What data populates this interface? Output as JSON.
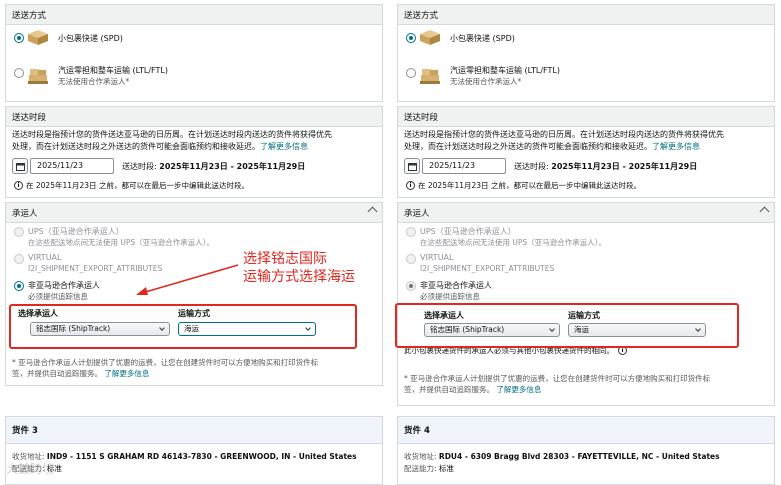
{
  "panels": [
    {
      "shipping_method": {
        "title": "送送方式",
        "options": [
          {
            "label": "小包裹快递 (SPD)",
            "sublabel": "",
            "selected": true,
            "icon": "small-parcel-icon"
          },
          {
            "label": "汽运零担和整车运输 (LTL/FTL)",
            "sublabel": "无法使用合作承运人*",
            "selected": false,
            "icon": "pallet-icon"
          }
        ]
      },
      "delivery_window": {
        "title": "送达时段",
        "description_line1": "送达时段是指预计您的货件送达亚马逊的日历周。在计划送达时段内送达的货件将获得优先",
        "description_line2": "处理，而在计划送达时段之外送达的货件可能会面临预约和接收延迟。",
        "learn_more": "了解更多信息",
        "date_value": "2025/11/23",
        "window_label": "送达时段:",
        "window_value": "2025年11月23日 - 2025年11月29日",
        "info": "在 2025年11月23日 之前，都可以在最后一步中编辑此送达时段。"
      },
      "carrier": {
        "title": "承运人",
        "options": [
          {
            "label": "UPS（亚马逊合作承运人）",
            "sublabel": "在这些配送地点间无法使用 UPS（亚马逊合作承运人）。",
            "selected": false,
            "disabled": true
          },
          {
            "label": "VIRTUAL",
            "sublabel": "I2I_SHIPMENT_EXPORT_ATTRIBUTES",
            "selected": false,
            "disabled": true
          },
          {
            "label": "非亚马逊合作承运人",
            "sublabel": "必须提供追踪信息",
            "selected": true,
            "disabled": false
          }
        ],
        "select_carrier_label": "选择承运人",
        "select_carrier_value": "铭志国际 (ShipTrack)",
        "transport_mode_label": "运输方式",
        "transport_mode_value": "海运",
        "note_line1": "* 亚马逊合作承运人计划提供了优惠的运费，让您在创建货件时可以方便地购买和打印货件标",
        "note_line2": "签，并提供自动追踪服务。",
        "note_link": "了解更多信息"
      },
      "shipment": {
        "title": "货件 3",
        "address_label": "收货地址:",
        "address_value": "IND9 - 1151 S GRAHAM RD 46143-7830 - GREENWOOD, IN - United States",
        "capability_label": "配送能力:",
        "capability_value": "标准"
      }
    },
    {
      "shipping_method": {
        "title": "送送方式",
        "options": [
          {
            "label": "小包裹快递 (SPD)",
            "sublabel": "",
            "selected": true,
            "icon": "small-parcel-icon"
          },
          {
            "label": "汽运零担和整车运输 (LTL/FTL)",
            "sublabel": "无法使用合作承运人*",
            "selected": false,
            "icon": "pallet-icon"
          }
        ]
      },
      "delivery_window": {
        "title": "送达时段",
        "description_line1": "送达时段是指预计您的货件送达亚马逊的日历周。在计划送达时段内送达的货件将获得优先",
        "description_line2": "处理，而在计划送达时段之外送达的货件可能会面临预约和接收延迟。",
        "learn_more": "了解更多信息",
        "date_value": "2025/11/23",
        "window_label": "送达时段:",
        "window_value": "2025年11月23日 - 2025年11月29日",
        "info": "在 2025年11月23日 之前，都可以在最后一步中编辑此送达时段。"
      },
      "carrier": {
        "title": "承运人",
        "options": [
          {
            "label": "UPS（亚马逊合作承运人）",
            "sublabel": "在这些配送地点间无法使用 UPS（亚马逊合作承运人）。",
            "selected": false,
            "disabled": true
          },
          {
            "label": "VIRTUAL",
            "sublabel": "I2I_SHIPMENT_EXPORT_ATTRIBUTES",
            "selected": false,
            "disabled": true
          },
          {
            "label": "非亚马逊合作承运人",
            "sublabel": "必须提供追踪信息",
            "selected": true,
            "disabled": true
          }
        ],
        "select_carrier_label": "选择承运人",
        "select_carrier_value": "铭志国际 (ShipTrack)",
        "transport_mode_label": "运输方式",
        "transport_mode_value": "海运",
        "extra_line": "此小包裹快递货件的承运人必须与其他小包裹快递货件的相同。",
        "note_line1": "* 亚马逊合作承运人计划提供了优惠的运费，让您在创建货件时可以方便地购买和打印货件标",
        "note_line2": "签，并提供自动追踪服务。",
        "note_link": "了解更多信息"
      },
      "shipment": {
        "title": "货件 4",
        "address_label": "收货地址:",
        "address_value": "RDU4 - 6309 Bragg Blvd 28303 - FAYETTEVILLE, NC - United States",
        "capability_label": "配送能力:",
        "capability_value": "标准"
      }
    }
  ],
  "annotation": {
    "line1": "选择铭志国际",
    "line2": "运输方式选择海运",
    "color": "#e0281f"
  },
  "watermark": "大鼓跨境",
  "colors": {
    "accent": "#007185",
    "highlight_box": "#e0281f",
    "header_bg": "#f0f2f2"
  }
}
